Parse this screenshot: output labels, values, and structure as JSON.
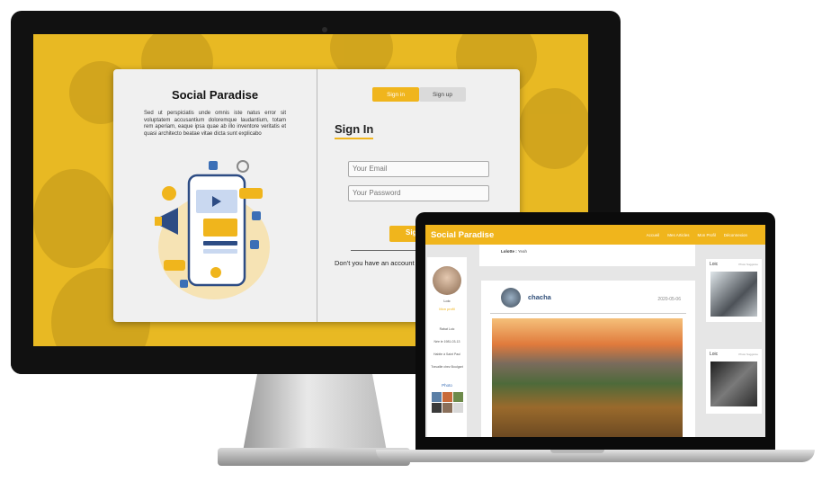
{
  "imac": {
    "left_panel": {
      "title": "Social Paradise",
      "description": "Sed ut perspiciatis unde omnis iste natus error sit voluptatem accusantium doloremque laudantium, totam rem aperiam, eaque ipsa quae ab illo inventore veritatis et quasi architecto beatae vitae dicta sunt explicabo"
    },
    "tabs": [
      "Sign in",
      "Sign up"
    ],
    "form": {
      "title": "Sign In",
      "email_placeholder": "Your Email",
      "password_placeholder": "Your Password",
      "submit_label": "Sig",
      "account_text": "Don't you have an account ? easy!"
    }
  },
  "macbook": {
    "brand": "Social Paradise",
    "nav": [
      "Accueil",
      "Mes Articles",
      "Mon Profil",
      "Déconnexion"
    ],
    "comment": {
      "author": "Lolotte :",
      "text": "Yeah"
    },
    "profile": {
      "name": "Loic",
      "link": "Mon profil",
      "info": [
        "Rabat Loic",
        "Née le 1981-03-13",
        "Habite à Saint Paul",
        "Travaille chez Boulgart"
      ],
      "photo_label": "Photo"
    },
    "post": {
      "author": "chacha",
      "date": "2020-05-06"
    },
    "suggestions": [
      {
        "name": "Loic",
        "label": "Photo Suggérée"
      },
      {
        "name": "Loic",
        "label": "Photo Suggérée"
      }
    ]
  },
  "colors": {
    "accent": "#f0b51c",
    "link": "#2e4d78"
  }
}
